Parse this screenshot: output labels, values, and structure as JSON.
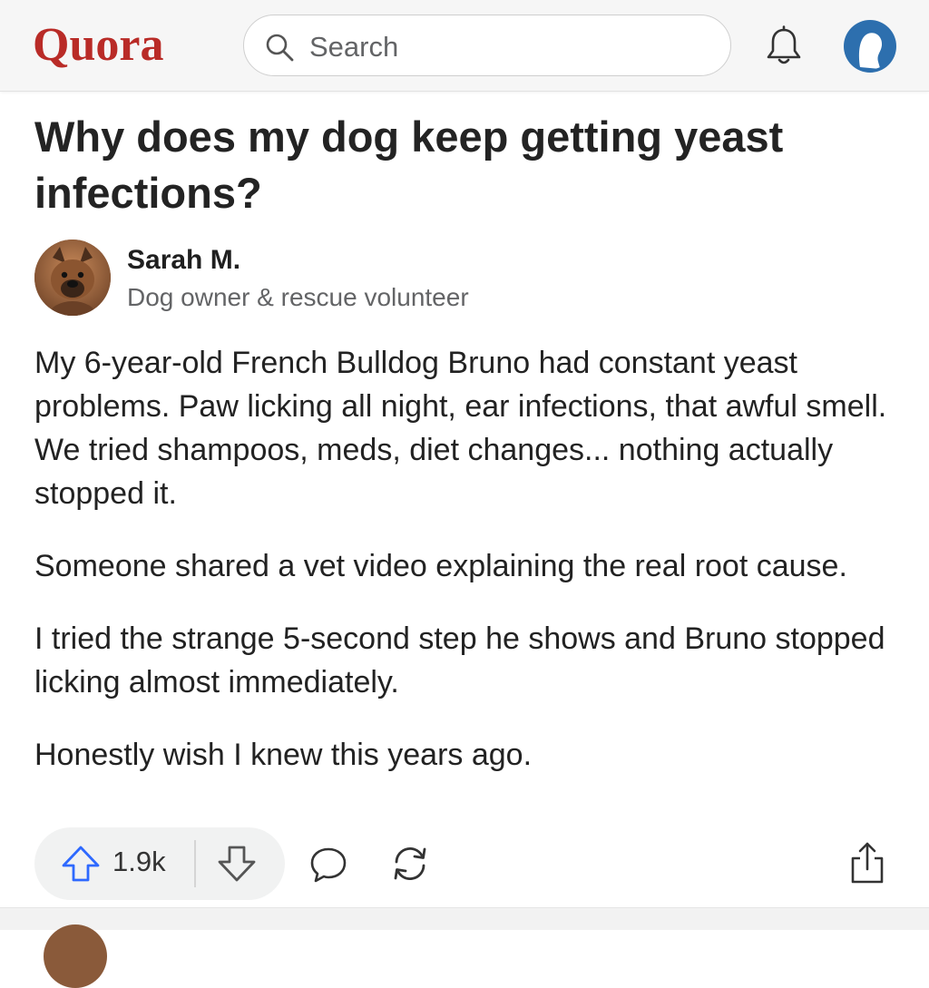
{
  "header": {
    "logo": "Quora",
    "search": {
      "placeholder": "Search",
      "value": ""
    },
    "icons": {
      "search": "search-icon",
      "bell": "bell-icon",
      "avatar": "profile-avatar"
    }
  },
  "question": {
    "title": "Why does my dog keep getting yeast infections?"
  },
  "answer": {
    "author": {
      "name": "Sarah M.",
      "credential": "Dog owner & rescue volunteer"
    },
    "paragraphs": [
      "My 6-year-old French Bulldog Bruno had constant yeast problems. Paw licking all night, ear infections, that awful smell. We tried shampoos, meds, diet changes... nothing actually stopped it.",
      "Someone shared a vet video explaining the real root cause.",
      "I tried the strange 5-second step he shows and Bruno stopped licking almost immediately.",
      "Honestly wish I knew this years ago."
    ]
  },
  "actions": {
    "upvote_count": "1.9k",
    "icons": [
      "upvote-icon",
      "downvote-icon",
      "comment-icon",
      "reshare-icon",
      "share-icon"
    ]
  },
  "colors": {
    "brand": "#b92b27",
    "upvote": "#2e69ff",
    "avatar_bg": "#2d6fae"
  }
}
